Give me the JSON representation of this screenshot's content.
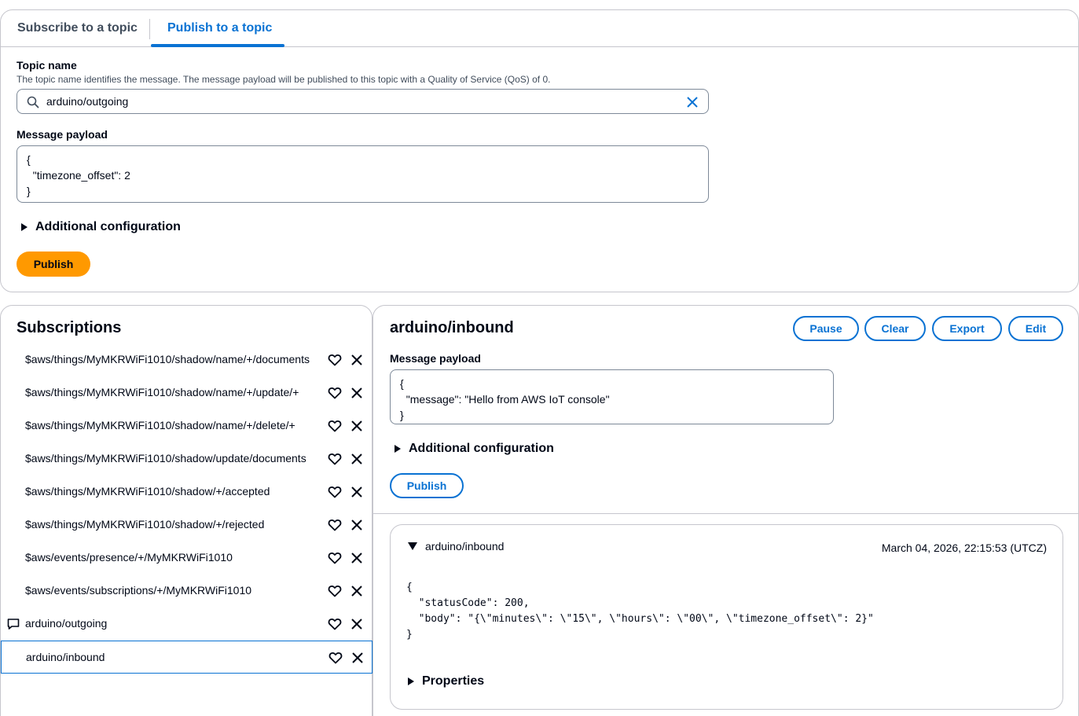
{
  "tabs": [
    {
      "label": "Subscribe to a topic",
      "active": false
    },
    {
      "label": "Publish to a topic",
      "active": true
    }
  ],
  "publish": {
    "topic_label": "Topic name",
    "topic_description": "The topic name identifies the message. The message payload will be published to this topic with a Quality of Service (QoS) of 0.",
    "topic_value": "arduino/outgoing",
    "payload_label": "Message payload",
    "payload_value": "{\n  \"timezone_offset\": 2\n}",
    "additional_config": "Additional configuration",
    "publish_button": "Publish"
  },
  "subscriptions": {
    "title": "Subscriptions",
    "items": [
      {
        "topic": "$aws/things/MyMKRWiFi1010/shadow/name/+/documents"
      },
      {
        "topic": "$aws/things/MyMKRWiFi1010/shadow/name/+/update/+"
      },
      {
        "topic": "$aws/things/MyMKRWiFi1010/shadow/name/+/delete/+"
      },
      {
        "topic": "$aws/things/MyMKRWiFi1010/shadow/update/documents"
      },
      {
        "topic": "$aws/things/MyMKRWiFi1010/shadow/+/accepted"
      },
      {
        "topic": "$aws/things/MyMKRWiFi1010/shadow/+/rejected"
      },
      {
        "topic": "$aws/events/presence/+/MyMKRWiFi1010"
      },
      {
        "topic": "$aws/events/subscriptions/+/MyMKRWiFi1010"
      },
      {
        "topic": "arduino/outgoing"
      },
      {
        "topic": "arduino/inbound"
      }
    ]
  },
  "detail": {
    "title": "arduino/inbound",
    "buttons": {
      "pause": "Pause",
      "clear": "Clear",
      "export": "Export",
      "edit": "Edit"
    },
    "payload_label": "Message payload",
    "payload_value": "{\n  \"message\": \"Hello from AWS IoT console\"\n}",
    "additional_config": "Additional configuration",
    "publish_button": "Publish",
    "message": {
      "topic": "arduino/inbound",
      "timestamp": "March 04, 2026, 22:15:53 (UTCZ)",
      "body": "{\n  \"statusCode\": 200,\n  \"body\": \"{\\\"minutes\\\": \\\"15\\\", \\\"hours\\\": \\\"00\\\", \\\"timezone_offset\\\": 2}\"\n}",
      "properties": "Properties"
    }
  },
  "colors": {
    "accent": "#0972d3",
    "primary_button": "#ff9900",
    "border": "#c6c6cd"
  }
}
